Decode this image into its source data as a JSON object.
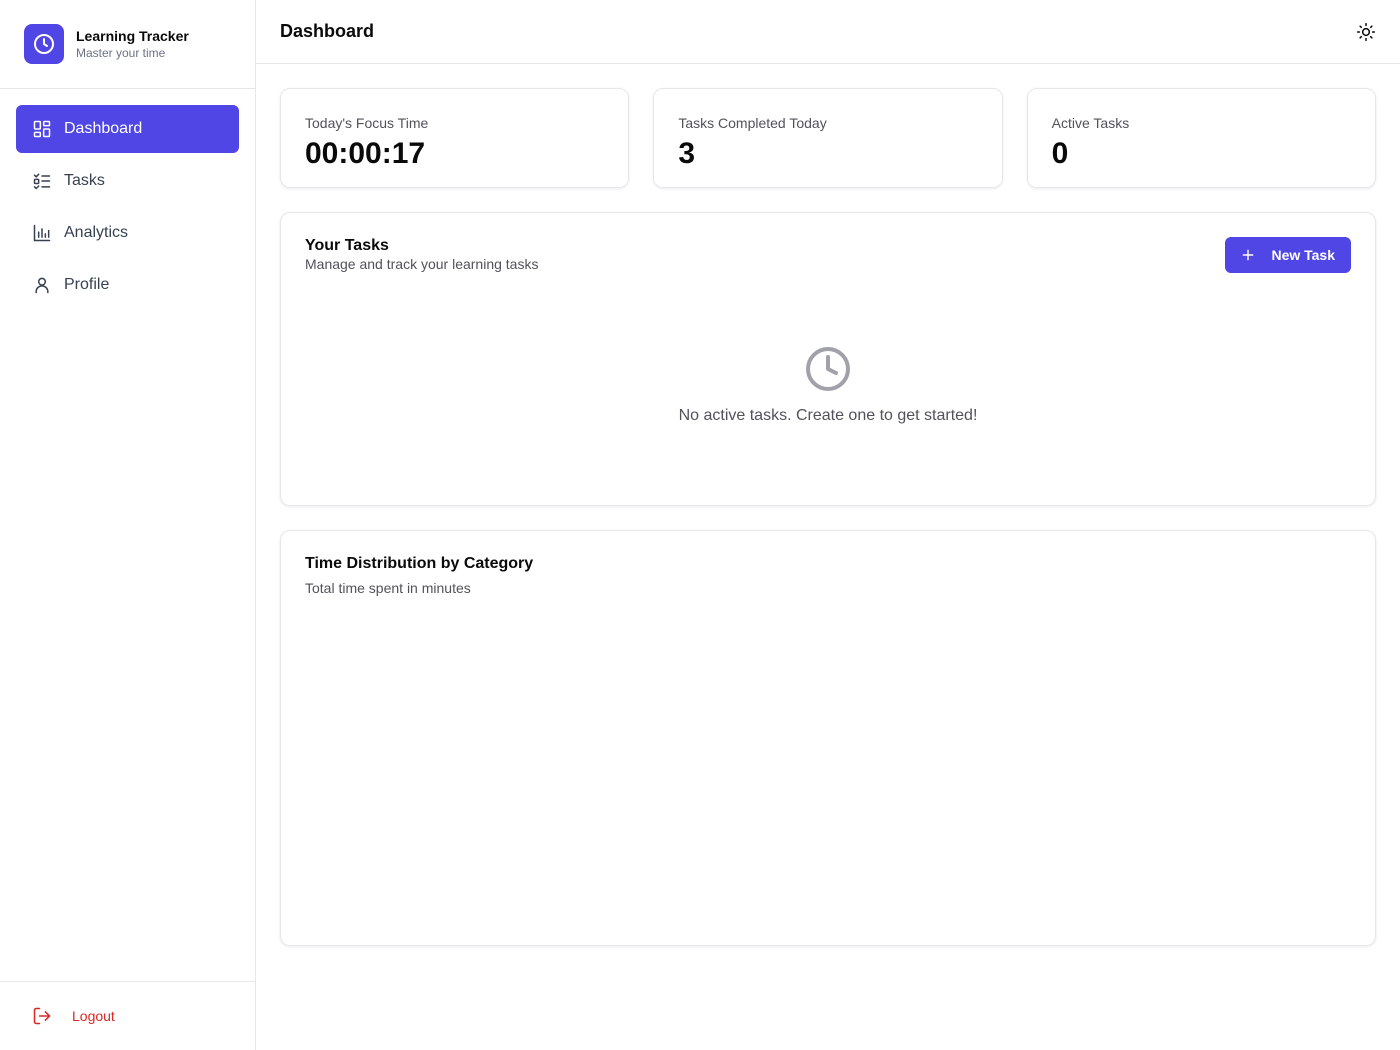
{
  "brand": {
    "title": "Learning Tracker",
    "subtitle": "Master your time",
    "icon": "clock-icon",
    "color": "#4f46e5"
  },
  "nav": {
    "items": [
      {
        "label": "Dashboard",
        "icon": "dashboard-icon",
        "active": true
      },
      {
        "label": "Tasks",
        "icon": "tasks-list-icon",
        "active": false
      },
      {
        "label": "Analytics",
        "icon": "bar-chart-icon",
        "active": false
      },
      {
        "label": "Profile",
        "icon": "user-icon",
        "active": false
      }
    ]
  },
  "footer": {
    "logout_label": "Logout",
    "logout_color": "#dc2626"
  },
  "header": {
    "title": "Dashboard",
    "theme_icon": "sun-icon"
  },
  "stats": [
    {
      "label": "Today's Focus Time",
      "value": "00:00:17"
    },
    {
      "label": "Tasks Completed Today",
      "value": "3"
    },
    {
      "label": "Active Tasks",
      "value": "0"
    }
  ],
  "tasks": {
    "title": "Your Tasks",
    "subtitle": "Manage and track your learning tasks",
    "new_task_label": "New Task",
    "empty_message": "No active tasks. Create one to get started!"
  },
  "distribution": {
    "title": "Time Distribution by Category",
    "subtitle": "Total time spent in minutes"
  }
}
